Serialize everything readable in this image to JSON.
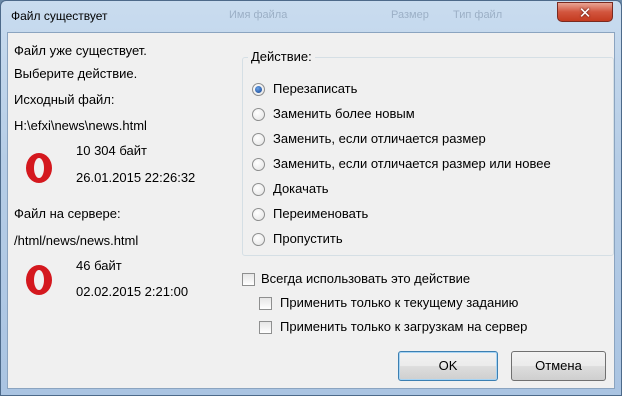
{
  "window": {
    "title": "Файл существует"
  },
  "background_titles": {
    "col1": "Имя файла",
    "col2": "Размер",
    "col3": "Тип файл"
  },
  "message": {
    "line1": "Файл уже существует.",
    "line2": "Выберите действие."
  },
  "source": {
    "heading": "Исходный файл:",
    "path": "H:\\efxi\\news\\news.html",
    "size": "10 304 байт",
    "date": "26.01.2015 22:26:32",
    "icon": "opera-icon"
  },
  "server": {
    "heading": "Файл на сервере:",
    "path": "/html/news/news.html",
    "size": "46 байт",
    "date": "02.02.2015 2:21:00",
    "icon": "opera-icon"
  },
  "action": {
    "title": "Действие:",
    "options": [
      {
        "label": "Перезаписать",
        "selected": true
      },
      {
        "label": "Заменить более новым",
        "selected": false
      },
      {
        "label": "Заменить, если отличается размер",
        "selected": false
      },
      {
        "label": "Заменить, если отличается размер или новее",
        "selected": false
      },
      {
        "label": "Докачать",
        "selected": false
      },
      {
        "label": "Переименовать",
        "selected": false
      },
      {
        "label": "Пропустить",
        "selected": false
      }
    ]
  },
  "checkboxes": {
    "always": {
      "label": "Всегда использовать это действие",
      "checked": false
    },
    "current_task": {
      "label": "Применить только к текущему заданию",
      "checked": false
    },
    "uploads": {
      "label": "Применить только к загрузкам на сервер",
      "checked": false
    }
  },
  "buttons": {
    "ok": "OK",
    "cancel": "Отмена"
  },
  "colors": {
    "opera_red": "#d4181e",
    "default_button_border": "#3c7fb1"
  }
}
